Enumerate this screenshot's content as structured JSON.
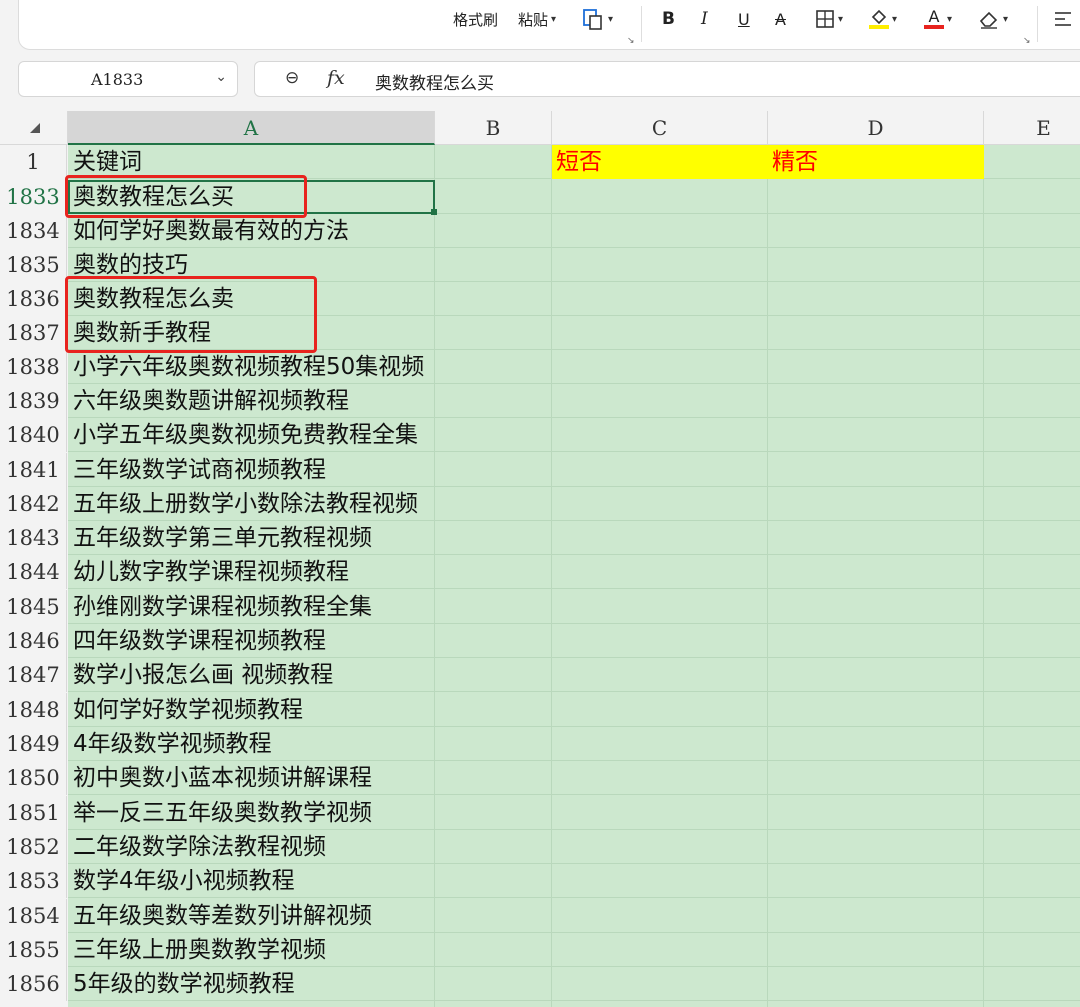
{
  "toolbar": {
    "format_painter": "格式刷",
    "paste": "粘贴",
    "bold": "B",
    "italic": "I",
    "underline": "U",
    "strikethrough": "A",
    "font_color_letter": "A",
    "fill_color": "#ffee00",
    "font_color": "#e8231e"
  },
  "name_box": {
    "value": "A1833"
  },
  "formula_bar": {
    "fx_label": "fx",
    "content": "奥数教程怎么买"
  },
  "columns": [
    "A",
    "B",
    "C",
    "D",
    "E"
  ],
  "selected_column": "A",
  "header_row": {
    "row": "1",
    "A": "关键词",
    "C": "短否",
    "D": "精否"
  },
  "rows": [
    {
      "row": "1833",
      "A": "奥数教程怎么买"
    },
    {
      "row": "1834",
      "A": "如何学好奥数最有效的方法"
    },
    {
      "row": "1835",
      "A": "奥数的技巧"
    },
    {
      "row": "1836",
      "A": "奥数教程怎么卖"
    },
    {
      "row": "1837",
      "A": "奥数新手教程"
    },
    {
      "row": "1838",
      "A": "小学六年级奥数视频教程50集视频"
    },
    {
      "row": "1839",
      "A": "六年级奥数题讲解视频教程"
    },
    {
      "row": "1840",
      "A": "小学五年级奥数视频免费教程全集"
    },
    {
      "row": "1841",
      "A": "三年级数学试商视频教程"
    },
    {
      "row": "1842",
      "A": "五年级上册数学小数除法教程视频"
    },
    {
      "row": "1843",
      "A": "五年级数学第三单元教程视频"
    },
    {
      "row": "1844",
      "A": "幼儿数字教学课程视频教程"
    },
    {
      "row": "1845",
      "A": "孙维刚数学课程视频教程全集"
    },
    {
      "row": "1846",
      "A": "四年级数学课程视频教程"
    },
    {
      "row": "1847",
      "A": "数学小报怎么画 视频教程"
    },
    {
      "row": "1848",
      "A": "如何学好数学视频教程"
    },
    {
      "row": "1849",
      "A": "4年级数学视频教程"
    },
    {
      "row": "1850",
      "A": "初中奥数小蓝本视频讲解课程"
    },
    {
      "row": "1851",
      "A": "举一反三五年级奥数教学视频"
    },
    {
      "row": "1852",
      "A": "二年级数学除法教程视频"
    },
    {
      "row": "1853",
      "A": "数学4年级小视频教程"
    },
    {
      "row": "1854",
      "A": "五年级奥数等差数列讲解视频"
    },
    {
      "row": "1855",
      "A": "三年级上册奥数教学视频"
    },
    {
      "row": "1856",
      "A": "5年级的数学视频教程"
    }
  ]
}
